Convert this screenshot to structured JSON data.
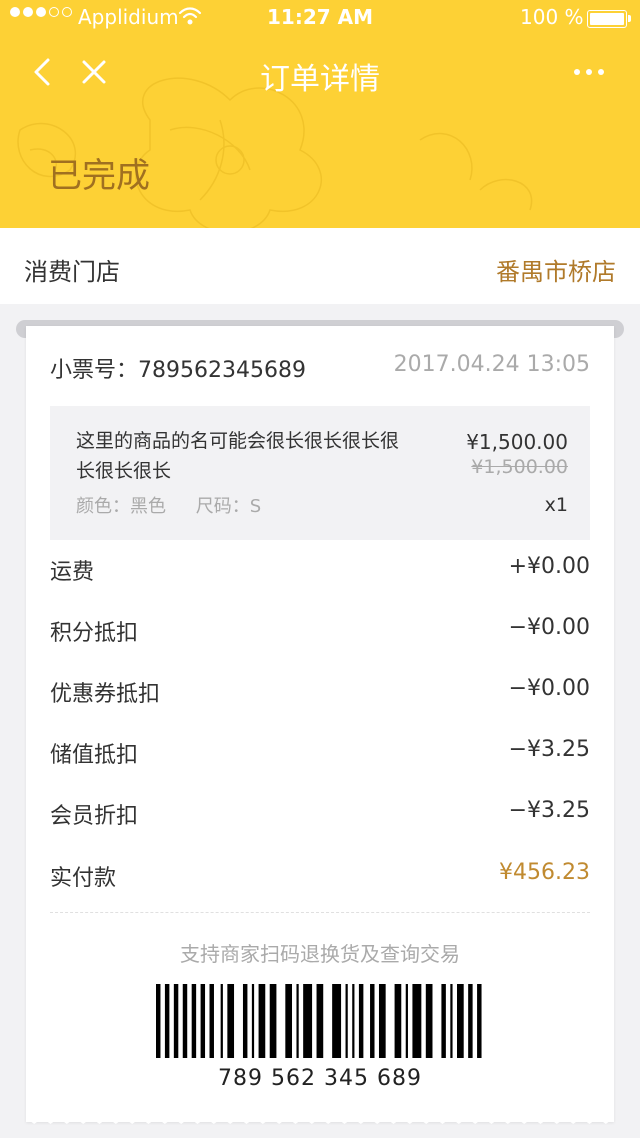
{
  "status_bar": {
    "carrier": "Applidium",
    "time": "11:27 AM",
    "battery": "100 %"
  },
  "nav": {
    "title": "订单详情",
    "back_icon": "chevron-left-icon",
    "close_icon": "close-icon",
    "more_icon": "more-dots-icon"
  },
  "order_status": "已完成",
  "store": {
    "label": "消费门店",
    "value": "番禺市桥店"
  },
  "receipt": {
    "ticket_label": "小票号：789562345689",
    "date": "2017.04.24 13:05",
    "product": {
      "name": "这里的商品的名可能会很长很长很长很长很长很长",
      "color": "颜色：黑色",
      "size": "尺码：S",
      "price": "¥1,500.00",
      "original_price": "¥1,500.00",
      "quantity": "x1"
    },
    "fees": [
      {
        "label": "运费",
        "value": "+¥0.00"
      },
      {
        "label": "积分抵扣",
        "value": "−¥0.00"
      },
      {
        "label": "优惠券抵扣",
        "value": "−¥0.00"
      },
      {
        "label": "储值抵扣",
        "value": "−¥3.25"
      },
      {
        "label": "会员折扣",
        "value": "−¥3.25"
      },
      {
        "label": "实付款",
        "value": "¥456.23"
      }
    ],
    "scan_note": "支持商家扫码退换货及查询交易",
    "barcode_number": "789 562 345 689"
  },
  "colors": {
    "header": "#fdd135",
    "accent": "#c08a30",
    "status_text": "#a07020"
  }
}
